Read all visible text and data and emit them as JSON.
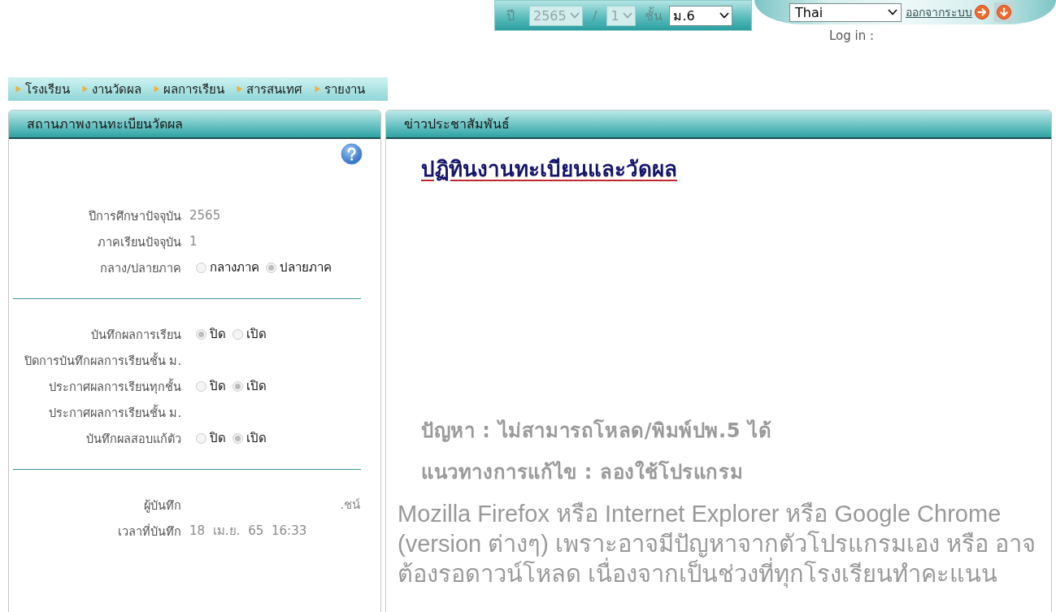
{
  "term_bar": {
    "year_label": "ปี",
    "year_select": {
      "value": "2565",
      "disabled": true
    },
    "separator": "/",
    "term_select": {
      "value": "1",
      "disabled": true
    },
    "grade_label": "ชั้น",
    "grade_select": {
      "value": "ม.6",
      "disabled": false
    }
  },
  "account_bar": {
    "language_select": "Thai",
    "logout_link": "ออกจากระบบ",
    "login_label": "Log in :"
  },
  "menu": [
    {
      "label": "โรงเรียน"
    },
    {
      "label": "งานวัดผล"
    },
    {
      "label": "ผลการเรียน"
    },
    {
      "label": "สารสนเทศ"
    },
    {
      "label": "รายงาน"
    }
  ],
  "status_panel": {
    "title": "สถานภาพงานทะเบียนวัดผล",
    "sections": [
      {
        "rows": [
          {
            "kind": "text",
            "label": "ปีการศึกษาปัจจุบัน",
            "value": "2565"
          },
          {
            "kind": "text",
            "label": "ภาคเรียนปัจจุบัน",
            "value": "1"
          },
          {
            "kind": "radio",
            "label": "กลาง/ปลายภาค",
            "disabled": true,
            "options": [
              {
                "label": "กลางภาค",
                "selected": false
              },
              {
                "label": "ปลายภาค",
                "selected": true
              }
            ]
          }
        ]
      },
      {
        "rows": [
          {
            "kind": "radio",
            "label": "บันทึกผลการเรียน",
            "disabled": true,
            "options": [
              {
                "label": "ปิด",
                "selected": true
              },
              {
                "label": "เปิด",
                "selected": false
              }
            ]
          },
          {
            "kind": "note",
            "label": "ปิดการบันทึกผลการเรียนชั้น  ม."
          },
          {
            "kind": "radio",
            "label": "ประกาศผลการเรียนทุกชั้น",
            "disabled": true,
            "options": [
              {
                "label": "ปิด",
                "selected": false
              },
              {
                "label": "เปิด",
                "selected": true
              }
            ]
          },
          {
            "kind": "note",
            "label": "ประกาศผลการเรียนชั้น  ม."
          },
          {
            "kind": "radio",
            "label": "บันทึกผลสอบแก้ตัว",
            "disabled": true,
            "options": [
              {
                "label": "ปิด",
                "selected": false
              },
              {
                "label": "เปิด",
                "selected": true
              }
            ]
          }
        ]
      },
      {
        "rows": [
          {
            "kind": "name",
            "label": "ผู้บันทึก",
            "value": ".ชน์"
          },
          {
            "kind": "text",
            "label": "เวลาที่บันทึก",
            "value": "18 เม.ย. 65 16:33"
          }
        ]
      }
    ]
  },
  "news_panel": {
    "title": "ข่าวประชาสัมพันธ์",
    "headline": "ปฏิทินงานทะเบียนและวัดผล",
    "problem": "ปัญหา : ไม่สามารถโหลด/พิมพ์ปพ.5 ได้",
    "solution": "แนวทางการแก้ไข : ลองใช้โปรแกรม",
    "body": "Mozilla Firefox หรือ Internet Explorer หรือ Google Chrome (version ต่างๆ) เพราะอาจมีปัญหาจากตัวโปรแกรมเอง หรือ อาจต้องรอดาวน์โหลด เนื่องจากเป็นช่วงที่ทุกโรงเรียนทำคะแนน"
  }
}
